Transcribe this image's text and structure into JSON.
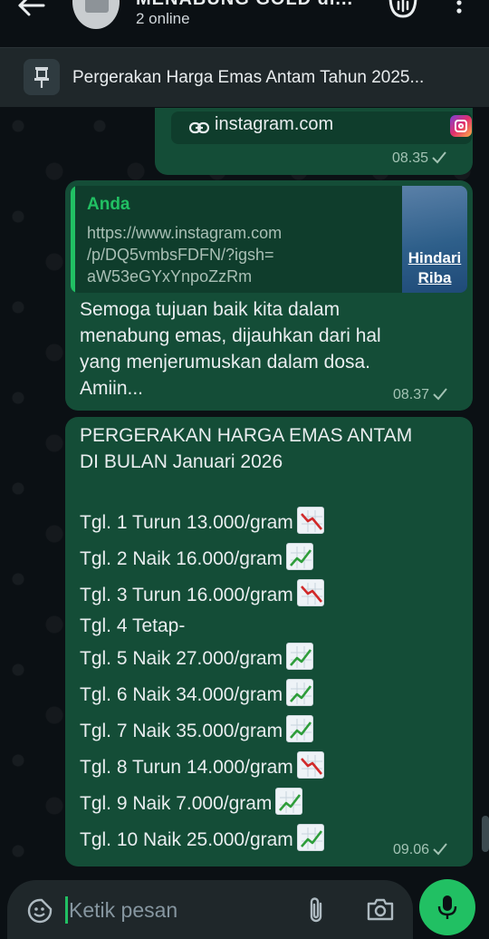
{
  "header": {
    "title": "MENABUNG GOLD di...",
    "subtitle": "2 online"
  },
  "pinned": {
    "text": "Pergerakan Harga Emas Antam Tahun 2025..."
  },
  "messages": [
    {
      "link_text": "instagram.com",
      "time": "08.35"
    },
    {
      "quote_author": "Anda",
      "quote_lines": [
        "https://www.instagram.com",
        "/p/DQ5vmbsFDFN/?igsh=",
        "aW53eGYxYnpoZzRm"
      ],
      "thumb_text": [
        "Hindari",
        "Riba"
      ],
      "lines": [
        "Semoga tujuan baik kita dalam",
        "menabung emas, dijauhkan dari hal",
        "yang menjerumuskan dalam dosa.",
        "Amiin..."
      ],
      "time": "08.37"
    },
    {
      "title_lines": [
        "PERGERAKAN HARGA EMAS ANTAM",
        "DI BULAN Januari 2026"
      ],
      "entries": [
        {
          "text": "Tgl. 1 Turun 13.000/gram",
          "trend": "down"
        },
        {
          "text": "Tgl. 2 Naik 16.000/gram",
          "trend": "up"
        },
        {
          "text": "Tgl. 3 Turun 16.000/gram",
          "trend": "down"
        },
        {
          "text": "Tgl. 4 Tetap-",
          "trend": ""
        },
        {
          "text": "Tgl. 5 Naik 27.000/gram",
          "trend": "up"
        },
        {
          "text": "Tgl. 6 Naik 34.000/gram",
          "trend": "up"
        },
        {
          "text": "Tgl. 7 Naik 35.000/gram",
          "trend": "up"
        },
        {
          "text": "Tgl. 8 Turun 14.000/gram",
          "trend": "down"
        },
        {
          "text": "Tgl. 9 Naik 7.000/gram",
          "trend": "up"
        },
        {
          "text": "Tgl. 10 Naik 25.000/gram",
          "trend": "up"
        }
      ],
      "time": "09.06"
    }
  ],
  "composer": {
    "placeholder": "Ketik pesan"
  },
  "colors": {
    "accent": "#21c063",
    "bubble": "#144d37",
    "background": "#0b1014"
  },
  "icons": {
    "back": "arrow-left-icon",
    "call": "voice-call-icon",
    "menu": "more-vert-icon",
    "pin": "pin-icon",
    "link": "link-icon",
    "instagram": "instagram-icon",
    "read": "check-icon",
    "sticker": "sticker-icon",
    "attach": "paperclip-icon",
    "camera": "camera-icon",
    "mic": "microphone-icon",
    "trend_up": "chart-increasing-icon",
    "trend_down": "chart-decreasing-icon"
  }
}
